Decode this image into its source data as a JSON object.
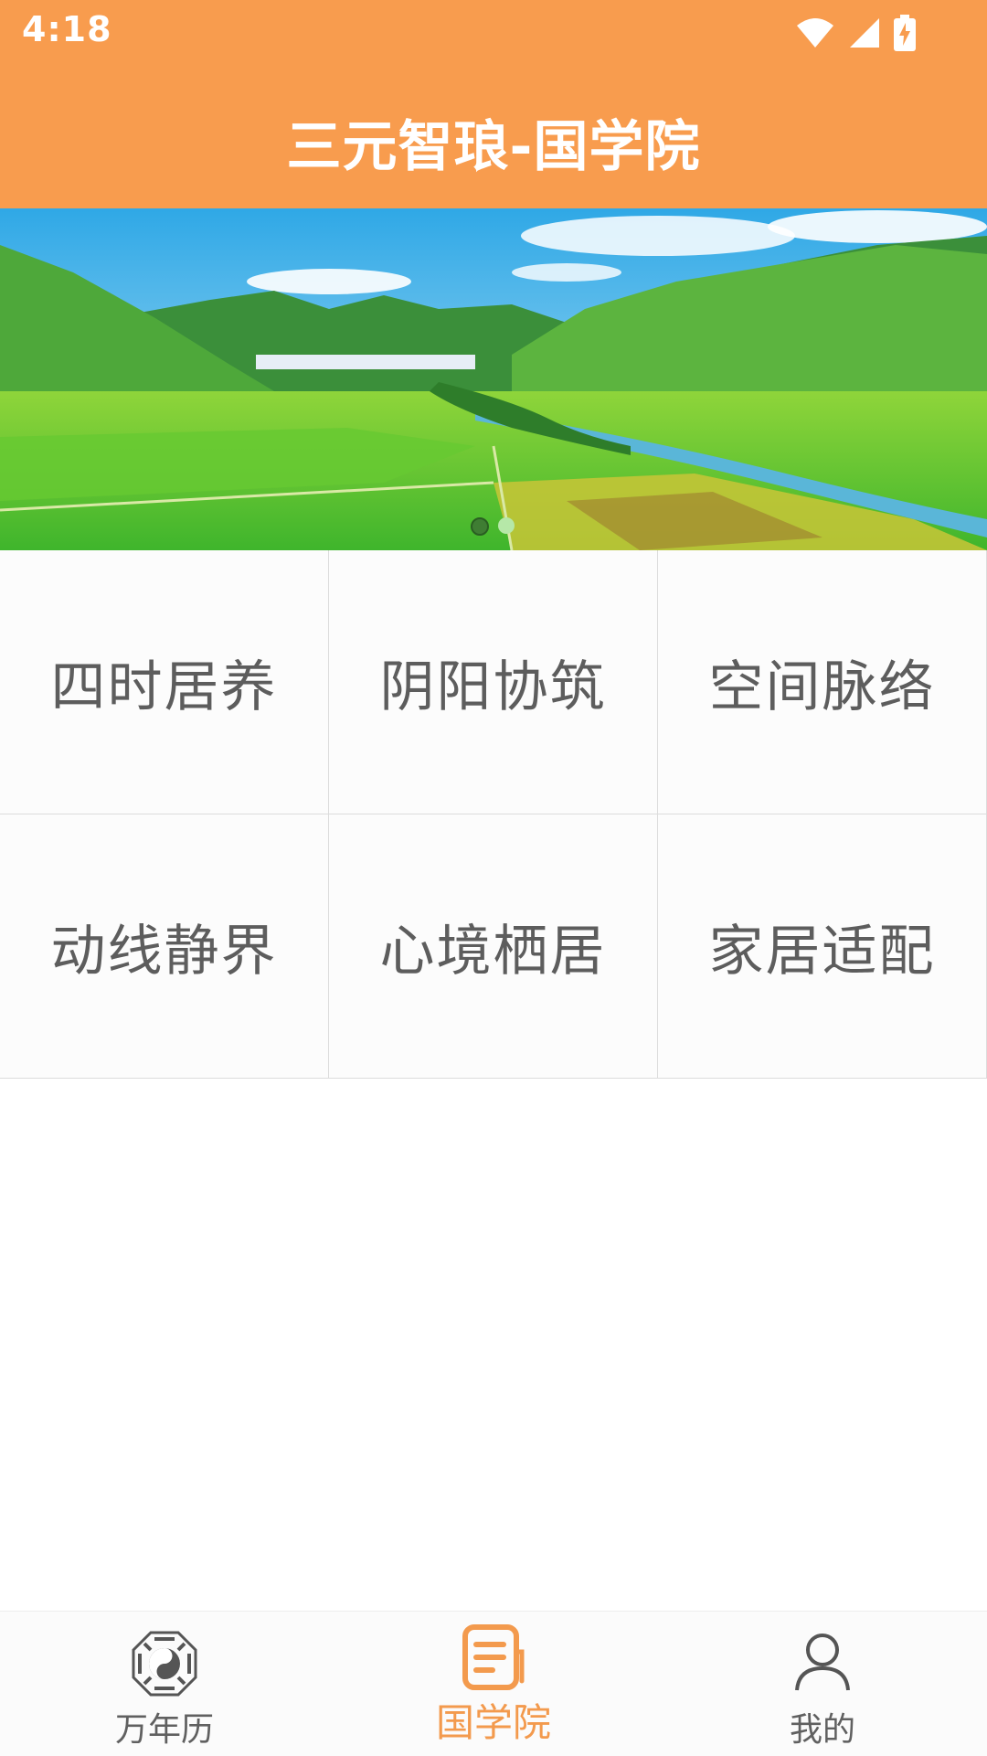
{
  "status_bar": {
    "time": "4:18"
  },
  "header": {
    "title": "三元智琅-国学院"
  },
  "banner": {
    "page_count": 2,
    "active_page": 1
  },
  "grid": {
    "items": [
      {
        "label": "四时居养"
      },
      {
        "label": "阴阳协筑"
      },
      {
        "label": "空间脉络"
      },
      {
        "label": "动线静界"
      },
      {
        "label": "心境栖居"
      },
      {
        "label": "家居适配"
      }
    ]
  },
  "bottom_nav": {
    "items": [
      {
        "label": "万年历",
        "icon": "bagua-icon"
      },
      {
        "label": "国学院",
        "icon": "document-icon",
        "active": true
      },
      {
        "label": "我的",
        "icon": "user-icon"
      }
    ]
  },
  "colors": {
    "header_bg": "#f89c4e",
    "active_nav": "#f39a4d",
    "grid_text": "#5d5d5d"
  }
}
